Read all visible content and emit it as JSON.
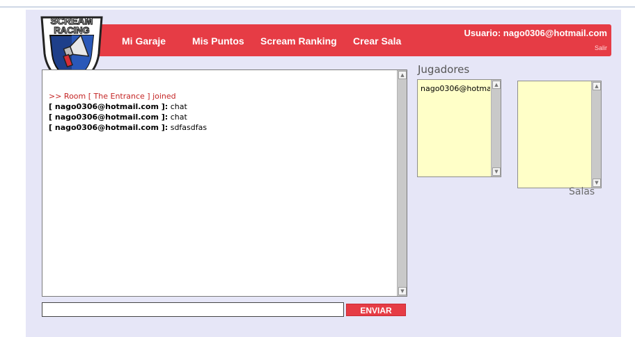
{
  "nav": {
    "items": [
      {
        "label": "Mi Garaje"
      },
      {
        "label": "Mis Puntos"
      },
      {
        "label": "Scream Ranking"
      },
      {
        "label": "Crear Sala"
      }
    ],
    "user_label": "Usuario: nago0306@hotmail.com",
    "logout_label": "Salir"
  },
  "logo": {
    "line1": "SCREAM",
    "line2": "RACING"
  },
  "chat": {
    "system_message": ">> Room [ The Entrance ] joined",
    "messages": [
      {
        "user": "[ nago0306@hotmail.com ]:",
        "text": " chat"
      },
      {
        "user": "[ nago0306@hotmail.com ]:",
        "text": " chat"
      },
      {
        "user": "[ nago0306@hotmail.com ]:",
        "text": " sdfasdfas"
      }
    ]
  },
  "players": {
    "title": "Jugadores",
    "entries": [
      "nago0306@hotma"
    ]
  },
  "rooms": {
    "title": "Salas",
    "entries": []
  },
  "input": {
    "value": "",
    "send_label": "ENVIAR"
  },
  "colors": {
    "accent": "#e63c45",
    "panel_bg": "#e6e6f7",
    "list_bg": "#ffffc8",
    "system_text": "#c42424"
  }
}
